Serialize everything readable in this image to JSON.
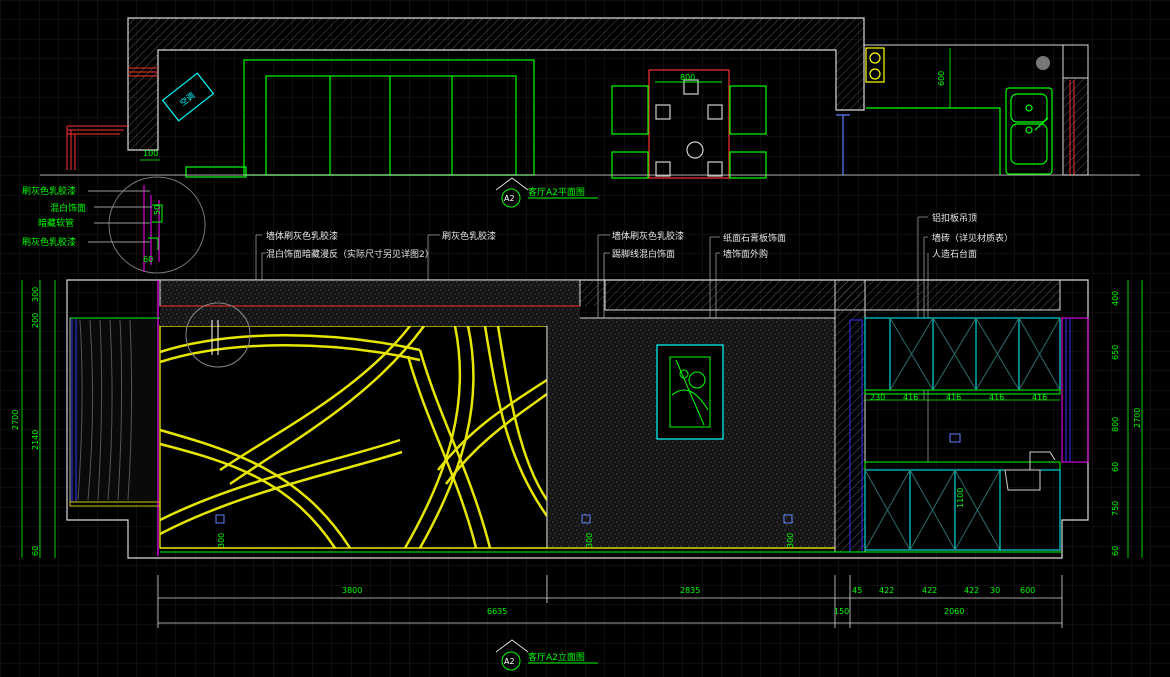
{
  "plan_view": {
    "marker": "A2",
    "title": "客厅A2平面图",
    "labels": {
      "ac": "空调",
      "dim_table": "800",
      "dim_counter": "600",
      "dim_wall": "100"
    }
  },
  "elevation_view": {
    "marker": "A2",
    "title": "客厅A2立面图"
  },
  "detail_callouts": [
    "刷灰色乳胶漆",
    "混白饰面",
    "暗藏软管",
    "刷灰色乳胶漆"
  ],
  "detail_dims": [
    "50",
    "60"
  ],
  "annotations_top": [
    "墙体刷灰色乳胶漆",
    "混白饰面暗藏漫反（实际尺寸另见详图2）",
    "刷灰色乳胶漆",
    "墙体刷灰色乳胶漆",
    "踢脚线混白饰面",
    "纸面石膏板饰面",
    "墙饰面外购",
    "铝扣板吊顶",
    "墙砖（详见材质表）",
    "人造石台面"
  ],
  "left_dims": [
    "300",
    "200",
    "2140",
    "2700",
    "60"
  ],
  "right_dims": [
    "400",
    "650",
    "800",
    "2700",
    "60",
    "750",
    "60"
  ],
  "cabinet_dims": [
    "230",
    "416",
    "416",
    "416",
    "416"
  ],
  "inner_dims": [
    "1100",
    "300",
    "300",
    "300"
  ],
  "bottom_dims_row1": [
    "3800",
    "2835",
    "45",
    "422",
    "422",
    "422",
    "30",
    "600"
  ],
  "bottom_dims_row2": [
    "6635",
    "150",
    "2060"
  ]
}
